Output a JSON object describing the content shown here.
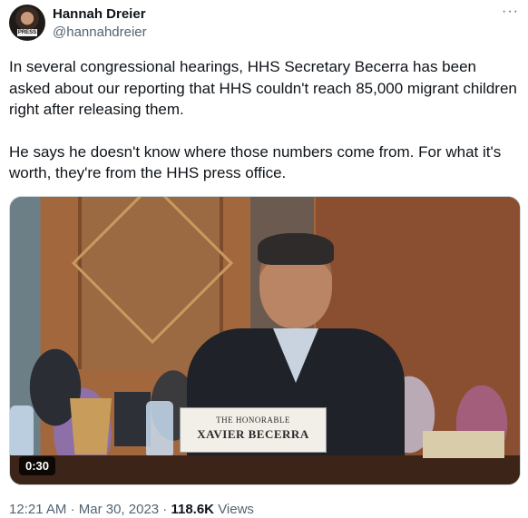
{
  "author": {
    "name": "Hannah Dreier",
    "handle": "@hannahdreier",
    "avatar_badge": "PRESS"
  },
  "menu_icon": "more-horizontal-icon",
  "tweet_text": {
    "paragraph1": "In several congressional hearings, HHS Secretary Becerra has been asked about our reporting that HHS couldn't reach 85,000 migrant children right after releasing them.",
    "paragraph2": "He says he doesn't know where those numbers come from. For what it's worth, they're from the HHS press office."
  },
  "media": {
    "nameplate_line1": "THE HONORABLE",
    "nameplate_line2": "XAVIER BECERRA",
    "duration": "0:30"
  },
  "meta": {
    "time": "12:21 AM",
    "separator": "·",
    "date": "Mar 30, 2023",
    "views_count": "118.6K",
    "views_label": "Views"
  },
  "colors": {
    "text": "#0f1419",
    "secondary": "#536471",
    "border": "#cfd9de"
  }
}
